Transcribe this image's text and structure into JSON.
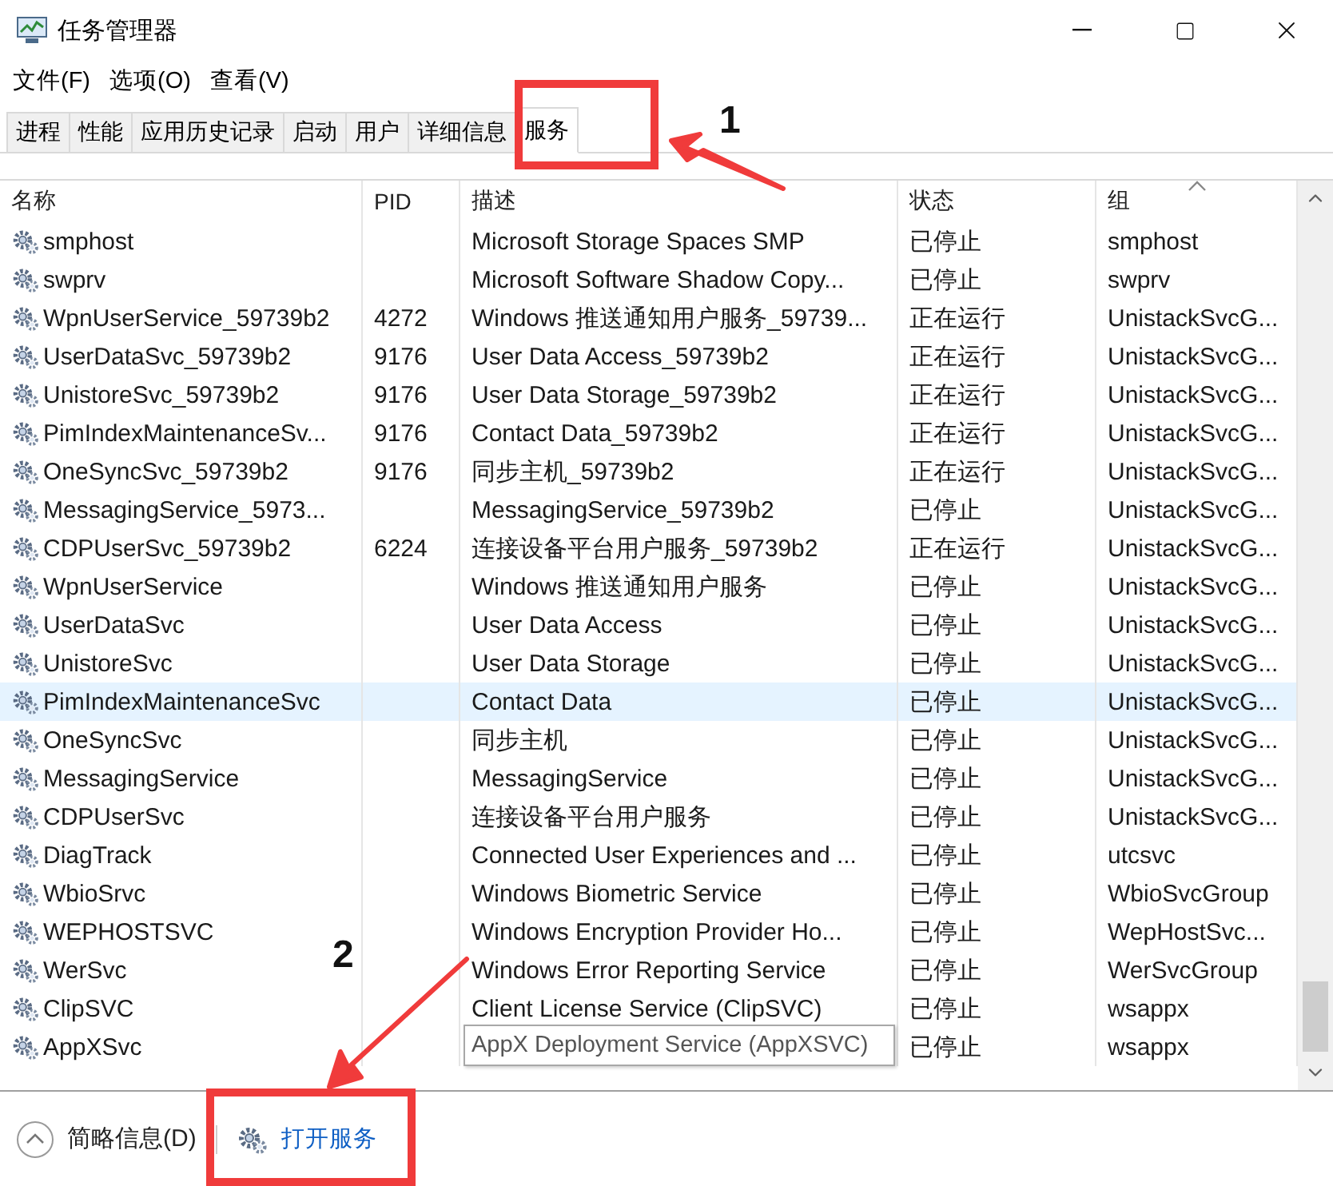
{
  "window": {
    "title": "任务管理器"
  },
  "menu": [
    "文件(F)",
    "选项(O)",
    "查看(V)"
  ],
  "tabs": [
    {
      "label": "进程",
      "selected": false
    },
    {
      "label": "性能",
      "selected": false
    },
    {
      "label": "应用历史记录",
      "selected": false
    },
    {
      "label": "启动",
      "selected": false
    },
    {
      "label": "用户",
      "selected": false
    },
    {
      "label": "详细信息",
      "selected": false
    },
    {
      "label": "服务",
      "selected": true
    }
  ],
  "table": {
    "columns": [
      "名称",
      "PID",
      "描述",
      "状态",
      "组"
    ],
    "rows": [
      {
        "name": "smphost",
        "description": "Microsoft Storage Spaces SMP",
        "status": "已停止",
        "group": "smphost",
        "selected": false
      },
      {
        "name": "swprv",
        "description": "Microsoft Software Shadow Copy...",
        "status": "已停止",
        "group": "swprv",
        "selected": false
      },
      {
        "name": "WpnUserService_59739b2",
        "pid": "4272",
        "description": "Windows 推送通知用户服务_59739...",
        "status": "正在运行",
        "group": "UnistackSvcG...",
        "selected": false
      },
      {
        "name": "UserDataSvc_59739b2",
        "pid": "9176",
        "description": "User Data Access_59739b2",
        "status": "正在运行",
        "group": "UnistackSvcG...",
        "selected": false
      },
      {
        "name": "UnistoreSvc_59739b2",
        "pid": "9176",
        "description": "User Data Storage_59739b2",
        "status": "正在运行",
        "group": "UnistackSvcG...",
        "selected": false
      },
      {
        "name": "PimIndexMaintenanceSv...",
        "pid": "9176",
        "description": "Contact Data_59739b2",
        "status": "正在运行",
        "group": "UnistackSvcG...",
        "selected": false
      },
      {
        "name": "OneSyncSvc_59739b2",
        "pid": "9176",
        "description": "同步主机_59739b2",
        "status": "正在运行",
        "group": "UnistackSvcG...",
        "selected": false
      },
      {
        "name": "MessagingService_5973...",
        "description": "MessagingService_59739b2",
        "status": "已停止",
        "group": "UnistackSvcG...",
        "selected": false
      },
      {
        "name": "CDPUserSvc_59739b2",
        "pid": "6224",
        "description": "连接设备平台用户服务_59739b2",
        "status": "正在运行",
        "group": "UnistackSvcG...",
        "selected": false
      },
      {
        "name": "WpnUserService",
        "description": "Windows 推送通知用户服务",
        "status": "已停止",
        "group": "UnistackSvcG...",
        "selected": false
      },
      {
        "name": "UserDataSvc",
        "description": "User Data Access",
        "status": "已停止",
        "group": "UnistackSvcG...",
        "selected": false
      },
      {
        "name": "UnistoreSvc",
        "description": "User Data Storage",
        "status": "已停止",
        "group": "UnistackSvcG...",
        "selected": false
      },
      {
        "name": "PimIndexMaintenanceSvc",
        "description": "Contact Data",
        "status": "已停止",
        "group": "UnistackSvcG...",
        "selected": true
      },
      {
        "name": "OneSyncSvc",
        "description": "同步主机",
        "status": "已停止",
        "group": "UnistackSvcG...",
        "selected": false
      },
      {
        "name": "MessagingService",
        "description": "MessagingService",
        "status": "已停止",
        "group": "UnistackSvcG...",
        "selected": false
      },
      {
        "name": "CDPUserSvc",
        "description": "连接设备平台用户服务",
        "status": "已停止",
        "group": "UnistackSvcG...",
        "selected": false
      },
      {
        "name": "DiagTrack",
        "description": "Connected User Experiences and ...",
        "status": "已停止",
        "group": "utcsvc",
        "selected": false
      },
      {
        "name": "WbioSrvc",
        "description": "Windows Biometric Service",
        "status": "已停止",
        "group": "WbioSvcGroup",
        "selected": false
      },
      {
        "name": "WEPHOSTSVC",
        "description": "Windows Encryption Provider Ho...",
        "status": "已停止",
        "group": "WepHostSvc...",
        "selected": false
      },
      {
        "name": "WerSvc",
        "description": "Windows Error Reporting Service",
        "status": "已停止",
        "group": "WerSvcGroup",
        "selected": false
      },
      {
        "name": "ClipSVC",
        "description": "Client License Service (ClipSVC)",
        "status": "已停止",
        "group": "wsappx",
        "selected": false
      },
      {
        "name": "AppXSvc",
        "status": "已停止",
        "group": "wsappx",
        "selected": false
      }
    ]
  },
  "tooltip": {
    "text": "AppX Deployment Service (AppXSVC)"
  },
  "footer": {
    "details_toggle": "简略信息(D)",
    "open_services_link": "打开服务"
  },
  "annotations": [
    {
      "label": "1"
    },
    {
      "label": "2"
    }
  ]
}
